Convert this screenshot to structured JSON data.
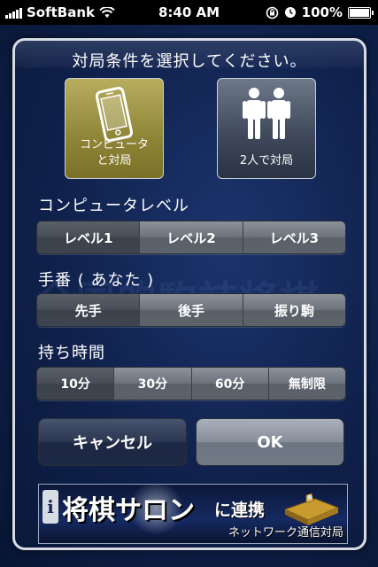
{
  "status_bar": {
    "carrier": "SoftBank",
    "time": "8:40 AM",
    "battery": "100%",
    "icons": [
      "signal-icon",
      "wifi-icon",
      "orientation-lock-icon",
      "alarm-icon",
      "battery-icon"
    ]
  },
  "dialog": {
    "title": "対局条件を選択してください。",
    "modes": [
      {
        "label_line1": "コンピュータ",
        "label_line2": "と対局",
        "icon": "phone-icon",
        "selected": true
      },
      {
        "label_line1": "2人で対局",
        "label_line2": "",
        "icon": "two-people-icon",
        "selected": false
      }
    ],
    "level": {
      "label": "コンピュータレベル",
      "options": [
        "レベル1",
        "レベル2",
        "レベル3"
      ],
      "selected_index": 0
    },
    "turn": {
      "label": "手番 ( あなた )",
      "options": [
        "先手",
        "後手",
        "振り駒"
      ],
      "selected_index": 0
    },
    "time": {
      "label": "持ち時間",
      "options": [
        "10分",
        "30分",
        "60分",
        "無制限"
      ],
      "selected_index": 0
    },
    "buttons": {
      "cancel": "キャンセル",
      "ok": "OK"
    },
    "banner": {
      "badge": "i",
      "main": "将棋サロン",
      "sub1": "に連携",
      "sub2": "ネットワーク通信対局"
    }
  },
  "colors": {
    "background": "#0b1a3c",
    "selected_mode": "#8f8537",
    "segment_selected": "#474d56"
  }
}
